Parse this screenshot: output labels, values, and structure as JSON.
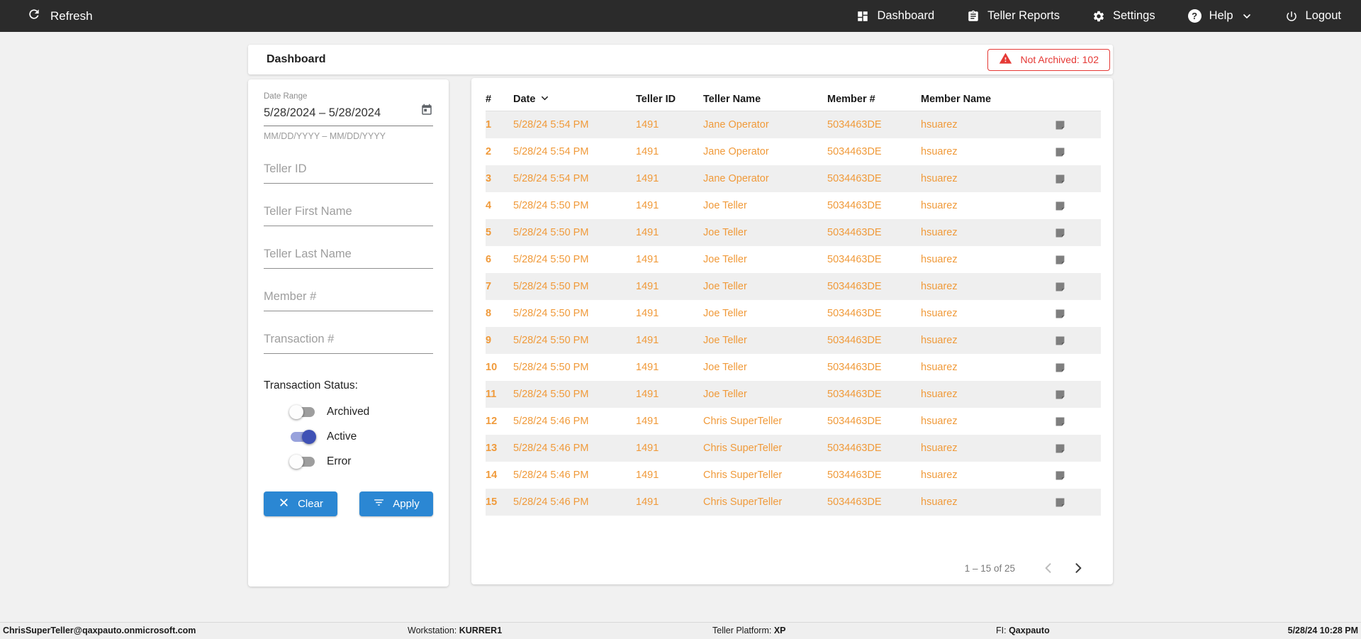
{
  "nav": {
    "refresh_label": "Refresh",
    "items": [
      {
        "label": "Dashboard"
      },
      {
        "label": "Teller Reports"
      },
      {
        "label": "Settings"
      },
      {
        "label": "Help"
      },
      {
        "label": "Logout"
      }
    ]
  },
  "header": {
    "title": "Dashboard",
    "badge": "Not Archived: 102"
  },
  "filters": {
    "date_range": {
      "label": "Date Range",
      "value": "5/28/2024 – 5/28/2024",
      "helper": "MM/DD/YYYY – MM/DD/YYYY"
    },
    "fields": [
      {
        "placeholder": "Teller ID"
      },
      {
        "placeholder": "Teller First Name"
      },
      {
        "placeholder": "Teller Last Name"
      },
      {
        "placeholder": "Member #"
      },
      {
        "placeholder": "Transaction #"
      }
    ],
    "status": {
      "label": "Transaction Status:",
      "toggles": [
        {
          "label": "Archived",
          "on": false
        },
        {
          "label": "Active",
          "on": true
        },
        {
          "label": "Error",
          "on": false
        }
      ]
    },
    "buttons": {
      "clear": "Clear",
      "apply": "Apply"
    }
  },
  "table": {
    "columns": [
      "#",
      "Date",
      "Teller ID",
      "Teller Name",
      "Member #",
      "Member Name"
    ],
    "rows": [
      {
        "n": "1",
        "date": "5/28/24 5:54 PM",
        "tid": "1491",
        "tname": "Jane Operator",
        "mnum": "5034463DE",
        "mname": "hsuarez"
      },
      {
        "n": "2",
        "date": "5/28/24 5:54 PM",
        "tid": "1491",
        "tname": "Jane Operator",
        "mnum": "5034463DE",
        "mname": "hsuarez"
      },
      {
        "n": "3",
        "date": "5/28/24 5:54 PM",
        "tid": "1491",
        "tname": "Jane Operator",
        "mnum": "5034463DE",
        "mname": "hsuarez"
      },
      {
        "n": "4",
        "date": "5/28/24 5:50 PM",
        "tid": "1491",
        "tname": "Joe Teller",
        "mnum": "5034463DE",
        "mname": "hsuarez"
      },
      {
        "n": "5",
        "date": "5/28/24 5:50 PM",
        "tid": "1491",
        "tname": "Joe Teller",
        "mnum": "5034463DE",
        "mname": "hsuarez"
      },
      {
        "n": "6",
        "date": "5/28/24 5:50 PM",
        "tid": "1491",
        "tname": "Joe Teller",
        "mnum": "5034463DE",
        "mname": "hsuarez"
      },
      {
        "n": "7",
        "date": "5/28/24 5:50 PM",
        "tid": "1491",
        "tname": "Joe Teller",
        "mnum": "5034463DE",
        "mname": "hsuarez"
      },
      {
        "n": "8",
        "date": "5/28/24 5:50 PM",
        "tid": "1491",
        "tname": "Joe Teller",
        "mnum": "5034463DE",
        "mname": "hsuarez"
      },
      {
        "n": "9",
        "date": "5/28/24 5:50 PM",
        "tid": "1491",
        "tname": "Joe Teller",
        "mnum": "5034463DE",
        "mname": "hsuarez"
      },
      {
        "n": "10",
        "date": "5/28/24 5:50 PM",
        "tid": "1491",
        "tname": "Joe Teller",
        "mnum": "5034463DE",
        "mname": "hsuarez"
      },
      {
        "n": "11",
        "date": "5/28/24 5:50 PM",
        "tid": "1491",
        "tname": "Joe Teller",
        "mnum": "5034463DE",
        "mname": "hsuarez"
      },
      {
        "n": "12",
        "date": "5/28/24 5:46 PM",
        "tid": "1491",
        "tname": "Chris SuperTeller",
        "mnum": "5034463DE",
        "mname": "hsuarez"
      },
      {
        "n": "13",
        "date": "5/28/24 5:46 PM",
        "tid": "1491",
        "tname": "Chris SuperTeller",
        "mnum": "5034463DE",
        "mname": "hsuarez"
      },
      {
        "n": "14",
        "date": "5/28/24 5:46 PM",
        "tid": "1491",
        "tname": "Chris SuperTeller",
        "mnum": "5034463DE",
        "mname": "hsuarez"
      },
      {
        "n": "15",
        "date": "5/28/24 5:46 PM",
        "tid": "1491",
        "tname": "Chris SuperTeller",
        "mnum": "5034463DE",
        "mname": "hsuarez"
      }
    ],
    "pagination": {
      "range": "1 – 15 of 25"
    }
  },
  "footer": {
    "user": "ChrisSuperTeller@qaxpauto.onmicrosoft.com",
    "workstation_label": "Workstation:",
    "workstation": "KURRER1",
    "platform_label": "Teller Platform:",
    "platform": "XP",
    "fi_label": "FI:",
    "fi": "Qaxpauto",
    "timestamp": "5/28/24 10:28 PM"
  },
  "colors": {
    "nav_bg": "#2b2b2b",
    "accent_blue": "#2b87d3",
    "accent_orange": "#f09a3a",
    "alert_red": "#e53935",
    "toggle_on": "#3f51b5"
  }
}
